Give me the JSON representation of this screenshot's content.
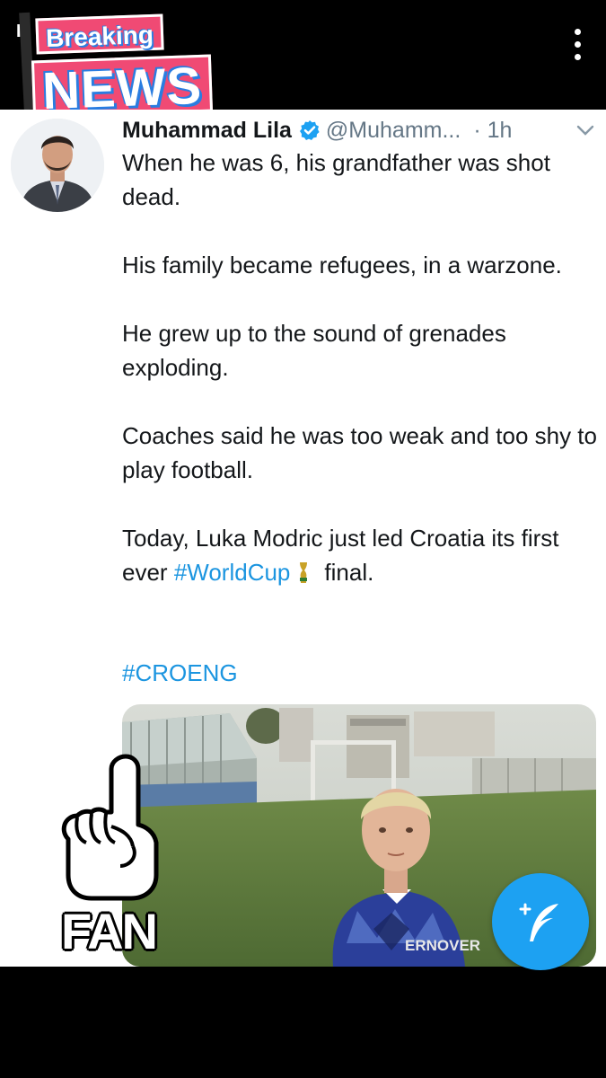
{
  "sticker": {
    "breaking": "Breaking",
    "news": "NEWS"
  },
  "tweet": {
    "name": "Muhammad Lila",
    "handle": "@Muhamm...",
    "time": "· 1h",
    "paragraphs": [
      "When he was 6, his grandfather was shot dead.",
      "His family became refugees, in a warzone.",
      "He grew up to the sound of grenades exploding.",
      "Coaches said he was too weak and too shy to play football."
    ],
    "last_line_prefix": "Today, Luka Modric just led Croatia its first ever ",
    "worldcup_tag": "#WorldCup",
    "last_line_suffix": "final.",
    "hashtag": "#CROENG"
  },
  "photo": {
    "shirt_text": "ERNOVER"
  },
  "fan_sticker": {
    "label": "FAN"
  },
  "icons": {
    "menu": "more-vert-icon",
    "verified": "verified-badge-icon",
    "chevron": "chevron-down-icon",
    "compose": "compose-tweet-icon",
    "trophy": "world-cup-trophy-icon"
  },
  "colors": {
    "link": "#1b95e0",
    "fab": "#1da1f2",
    "sticker": "#f04a74"
  }
}
